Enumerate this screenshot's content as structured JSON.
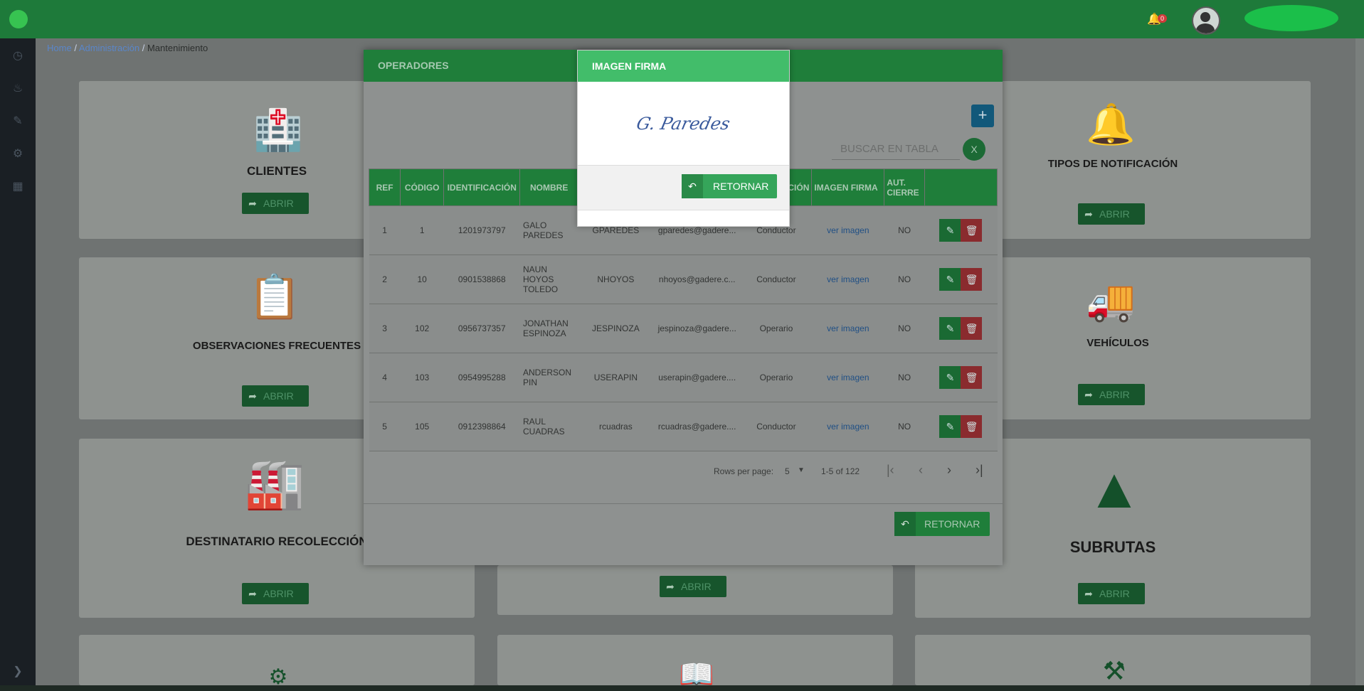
{
  "topbar": {
    "notification_count": "0"
  },
  "breadcrumb": {
    "home": "Home",
    "admin": "Administración",
    "current": "Mantenimiento"
  },
  "cards": [
    {
      "title": "CLIENTES",
      "button": "ABRIR"
    },
    {
      "title": "TIPOS DE NOTIFICACIÓN",
      "button": "ABRIR"
    },
    {
      "title": "OBSERVACIONES FRECUENTES",
      "button": "ABRIR"
    },
    {
      "title": "VEHÍCULOS",
      "button": "ABRIR"
    },
    {
      "title": "DESTINATARIO RECOLECCIÓN",
      "button": "ABRIR"
    },
    {
      "title": "",
      "button": "ABRIR"
    },
    {
      "title": "SUBRUTAS",
      "button": "ABRIR"
    }
  ],
  "operators_modal": {
    "title": "OPERADORES",
    "search_placeholder": "BUSCAR EN TABLA",
    "clear_label": "X",
    "add_label": "+",
    "headers": [
      "REF",
      "CÓDIGO",
      "IDENTIFICACIÓN",
      "NOMBRE",
      "",
      "",
      "CIÓN",
      "IMAGEN FIRMA",
      "AUT. CIERRE",
      ""
    ],
    "rows": [
      {
        "ref": "1",
        "code": "1",
        "id": "1201973797",
        "name": "GALO PAREDES",
        "user": "GPAREDES",
        "email": "gparedes@gadere...",
        "role": "Conductor",
        "image": "ver imagen",
        "aut": "NO"
      },
      {
        "ref": "2",
        "code": "10",
        "id": "0901538868",
        "name": "NAUN HOYOS TOLEDO",
        "user": "NHOYOS",
        "email": "nhoyos@gadere.c...",
        "role": "Conductor",
        "image": "ver imagen",
        "aut": "NO"
      },
      {
        "ref": "3",
        "code": "102",
        "id": "0956737357",
        "name": "JONATHAN ESPINOZA",
        "user": "JESPINOZA",
        "email": "jespinoza@gadere...",
        "role": "Operario",
        "image": "ver imagen",
        "aut": "NO"
      },
      {
        "ref": "4",
        "code": "103",
        "id": "0954995288",
        "name": "ANDERSON PIN",
        "user": "USERAPIN",
        "email": "userapin@gadere....",
        "role": "Operario",
        "image": "ver imagen",
        "aut": "NO"
      },
      {
        "ref": "5",
        "code": "105",
        "id": "0912398864",
        "name": "RAUL CUADRAS",
        "user": "rcuadras",
        "email": "rcuadras@gadere....",
        "role": "Conductor",
        "image": "ver imagen",
        "aut": "NO"
      }
    ],
    "pagination": {
      "rows_label": "Rows per page:",
      "rows_value": "5",
      "range": "1-5 of 122"
    },
    "return_label": "RETORNAR"
  },
  "signature_modal": {
    "title": "IMAGEN FIRMA",
    "signature_text": "G. Paredes",
    "return_label": "RETORNAR"
  },
  "colors": {
    "brand_green": "#1e7a3a",
    "accent_green": "#42bd6a",
    "danger": "#8a2b2e",
    "info": "#12587a"
  }
}
